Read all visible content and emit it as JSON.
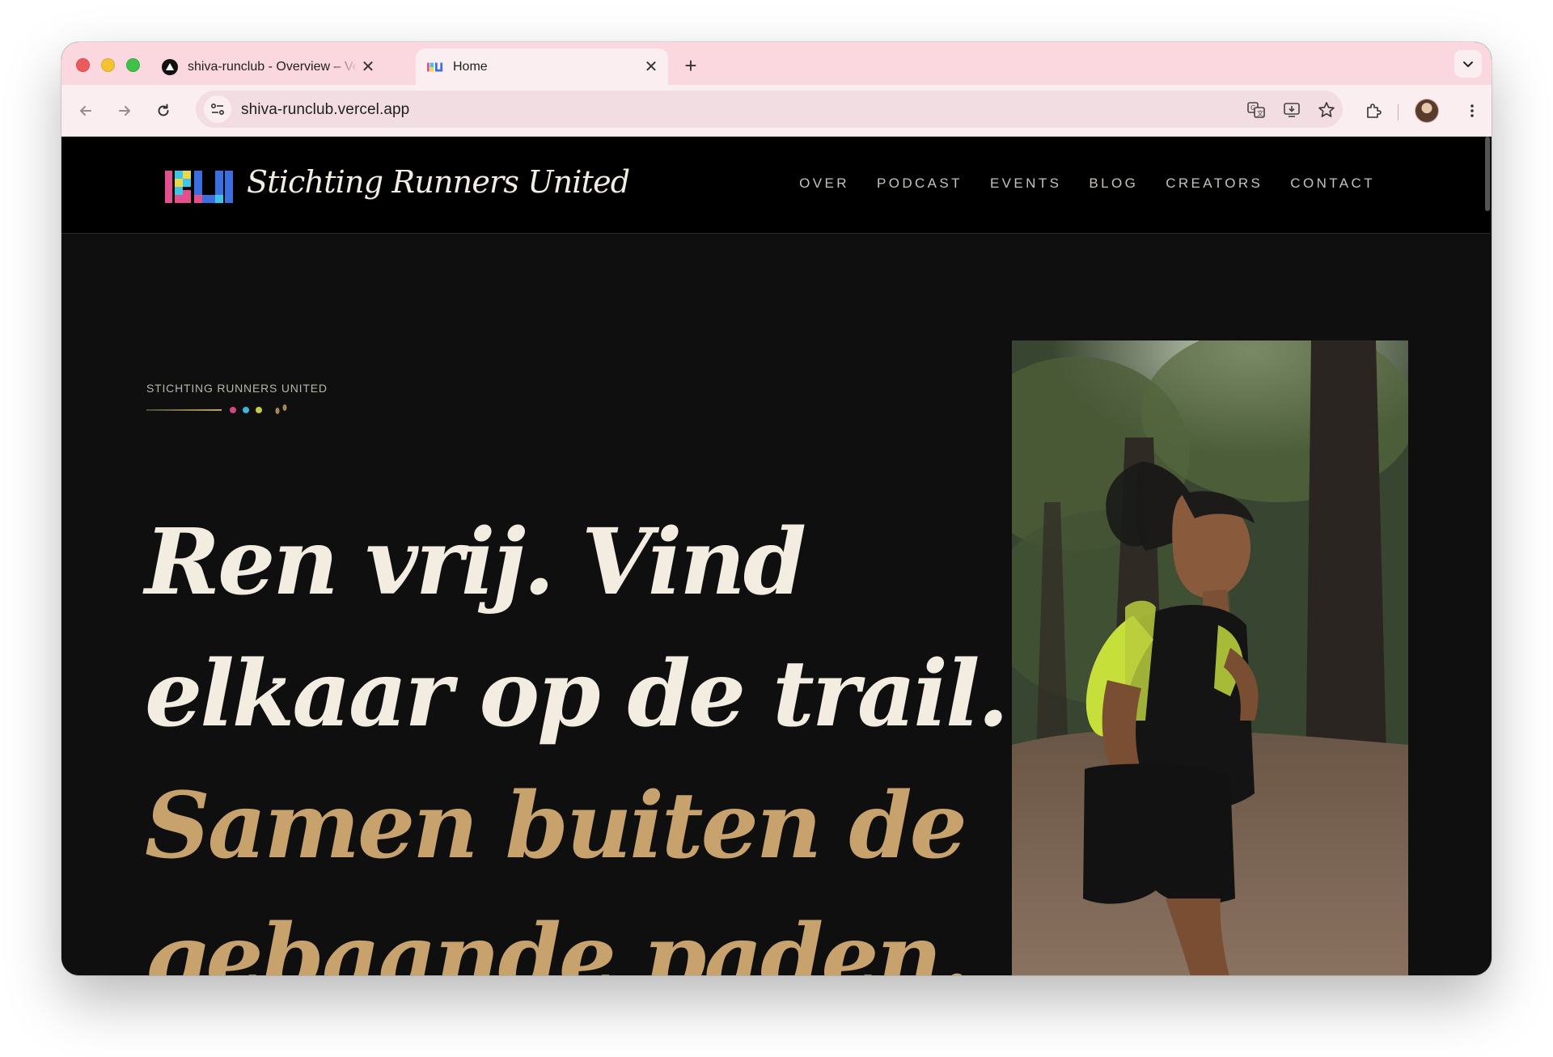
{
  "browser": {
    "tabs": [
      {
        "title": "shiva-runclub - Overview – Vercel",
        "favicon": "vercel-triangle-icon",
        "active": false
      },
      {
        "title": "Home",
        "favicon": "ru-logo-icon",
        "active": true
      }
    ],
    "url": "shiva-runclub.vercel.app",
    "accent_color": "#fbd7df"
  },
  "site": {
    "brand": "Stichting Runners United",
    "logo_letters": "RU",
    "nav": [
      "OVER",
      "PODCAST",
      "EVENTS",
      "BLOG",
      "CREATORS",
      "CONTACT"
    ]
  },
  "hero": {
    "eyebrow": "STICHTING RUNNERS UNITED",
    "headline_light": [
      "Ren vrij. Vind",
      "elkaar op de trail."
    ],
    "headline_gold": [
      "Samen buiten de",
      "gebaande paden."
    ],
    "image": "woman-trail-running-photo",
    "colors": {
      "text": "#f2ece1",
      "gold": "#c7a26d",
      "background": "#0f0f0f"
    }
  }
}
